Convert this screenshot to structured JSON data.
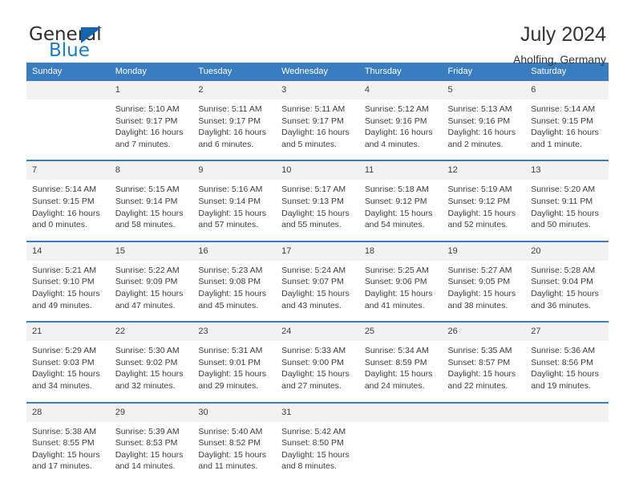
{
  "logo": {
    "text_primary": "General",
    "text_secondary": "Blue",
    "triangle_color": "#1565ad",
    "secondary_color": "#1b7cc2"
  },
  "header": {
    "title": "July 2024",
    "subtitle": "Aholfing, Germany"
  },
  "theme": {
    "header_bg": "#3a7cc0",
    "header_text": "#ffffff",
    "daynum_bg": "#f2f2f2",
    "row_divider": "#3a7cc0",
    "body_text": "#3d3d3d"
  },
  "calendar": {
    "weekday_headers": [
      "Sunday",
      "Monday",
      "Tuesday",
      "Wednesday",
      "Thursday",
      "Friday",
      "Saturday"
    ],
    "weeks": [
      [
        {
          "day": "",
          "lines": []
        },
        {
          "day": "1",
          "lines": [
            "Sunrise: 5:10 AM",
            "Sunset: 9:17 PM",
            "Daylight: 16 hours",
            "and 7 minutes."
          ]
        },
        {
          "day": "2",
          "lines": [
            "Sunrise: 5:11 AM",
            "Sunset: 9:17 PM",
            "Daylight: 16 hours",
            "and 6 minutes."
          ]
        },
        {
          "day": "3",
          "lines": [
            "Sunrise: 5:11 AM",
            "Sunset: 9:17 PM",
            "Daylight: 16 hours",
            "and 5 minutes."
          ]
        },
        {
          "day": "4",
          "lines": [
            "Sunrise: 5:12 AM",
            "Sunset: 9:16 PM",
            "Daylight: 16 hours",
            "and 4 minutes."
          ]
        },
        {
          "day": "5",
          "lines": [
            "Sunrise: 5:13 AM",
            "Sunset: 9:16 PM",
            "Daylight: 16 hours",
            "and 2 minutes."
          ]
        },
        {
          "day": "6",
          "lines": [
            "Sunrise: 5:14 AM",
            "Sunset: 9:15 PM",
            "Daylight: 16 hours",
            "and 1 minute."
          ]
        }
      ],
      [
        {
          "day": "7",
          "lines": [
            "Sunrise: 5:14 AM",
            "Sunset: 9:15 PM",
            "Daylight: 16 hours",
            "and 0 minutes."
          ]
        },
        {
          "day": "8",
          "lines": [
            "Sunrise: 5:15 AM",
            "Sunset: 9:14 PM",
            "Daylight: 15 hours",
            "and 58 minutes."
          ]
        },
        {
          "day": "9",
          "lines": [
            "Sunrise: 5:16 AM",
            "Sunset: 9:14 PM",
            "Daylight: 15 hours",
            "and 57 minutes."
          ]
        },
        {
          "day": "10",
          "lines": [
            "Sunrise: 5:17 AM",
            "Sunset: 9:13 PM",
            "Daylight: 15 hours",
            "and 55 minutes."
          ]
        },
        {
          "day": "11",
          "lines": [
            "Sunrise: 5:18 AM",
            "Sunset: 9:12 PM",
            "Daylight: 15 hours",
            "and 54 minutes."
          ]
        },
        {
          "day": "12",
          "lines": [
            "Sunrise: 5:19 AM",
            "Sunset: 9:12 PM",
            "Daylight: 15 hours",
            "and 52 minutes."
          ]
        },
        {
          "day": "13",
          "lines": [
            "Sunrise: 5:20 AM",
            "Sunset: 9:11 PM",
            "Daylight: 15 hours",
            "and 50 minutes."
          ]
        }
      ],
      [
        {
          "day": "14",
          "lines": [
            "Sunrise: 5:21 AM",
            "Sunset: 9:10 PM",
            "Daylight: 15 hours",
            "and 49 minutes."
          ]
        },
        {
          "day": "15",
          "lines": [
            "Sunrise: 5:22 AM",
            "Sunset: 9:09 PM",
            "Daylight: 15 hours",
            "and 47 minutes."
          ]
        },
        {
          "day": "16",
          "lines": [
            "Sunrise: 5:23 AM",
            "Sunset: 9:08 PM",
            "Daylight: 15 hours",
            "and 45 minutes."
          ]
        },
        {
          "day": "17",
          "lines": [
            "Sunrise: 5:24 AM",
            "Sunset: 9:07 PM",
            "Daylight: 15 hours",
            "and 43 minutes."
          ]
        },
        {
          "day": "18",
          "lines": [
            "Sunrise: 5:25 AM",
            "Sunset: 9:06 PM",
            "Daylight: 15 hours",
            "and 41 minutes."
          ]
        },
        {
          "day": "19",
          "lines": [
            "Sunrise: 5:27 AM",
            "Sunset: 9:05 PM",
            "Daylight: 15 hours",
            "and 38 minutes."
          ]
        },
        {
          "day": "20",
          "lines": [
            "Sunrise: 5:28 AM",
            "Sunset: 9:04 PM",
            "Daylight: 15 hours",
            "and 36 minutes."
          ]
        }
      ],
      [
        {
          "day": "21",
          "lines": [
            "Sunrise: 5:29 AM",
            "Sunset: 9:03 PM",
            "Daylight: 15 hours",
            "and 34 minutes."
          ]
        },
        {
          "day": "22",
          "lines": [
            "Sunrise: 5:30 AM",
            "Sunset: 9:02 PM",
            "Daylight: 15 hours",
            "and 32 minutes."
          ]
        },
        {
          "day": "23",
          "lines": [
            "Sunrise: 5:31 AM",
            "Sunset: 9:01 PM",
            "Daylight: 15 hours",
            "and 29 minutes."
          ]
        },
        {
          "day": "24",
          "lines": [
            "Sunrise: 5:33 AM",
            "Sunset: 9:00 PM",
            "Daylight: 15 hours",
            "and 27 minutes."
          ]
        },
        {
          "day": "25",
          "lines": [
            "Sunrise: 5:34 AM",
            "Sunset: 8:59 PM",
            "Daylight: 15 hours",
            "and 24 minutes."
          ]
        },
        {
          "day": "26",
          "lines": [
            "Sunrise: 5:35 AM",
            "Sunset: 8:57 PM",
            "Daylight: 15 hours",
            "and 22 minutes."
          ]
        },
        {
          "day": "27",
          "lines": [
            "Sunrise: 5:36 AM",
            "Sunset: 8:56 PM",
            "Daylight: 15 hours",
            "and 19 minutes."
          ]
        }
      ],
      [
        {
          "day": "28",
          "lines": [
            "Sunrise: 5:38 AM",
            "Sunset: 8:55 PM",
            "Daylight: 15 hours",
            "and 17 minutes."
          ]
        },
        {
          "day": "29",
          "lines": [
            "Sunrise: 5:39 AM",
            "Sunset: 8:53 PM",
            "Daylight: 15 hours",
            "and 14 minutes."
          ]
        },
        {
          "day": "30",
          "lines": [
            "Sunrise: 5:40 AM",
            "Sunset: 8:52 PM",
            "Daylight: 15 hours",
            "and 11 minutes."
          ]
        },
        {
          "day": "31",
          "lines": [
            "Sunrise: 5:42 AM",
            "Sunset: 8:50 PM",
            "Daylight: 15 hours",
            "and 8 minutes."
          ]
        },
        {
          "day": "",
          "lines": []
        },
        {
          "day": "",
          "lines": []
        },
        {
          "day": "",
          "lines": []
        }
      ]
    ]
  }
}
